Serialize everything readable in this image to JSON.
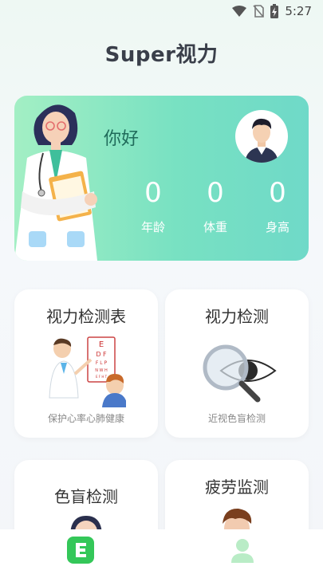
{
  "status_bar": {
    "time": "5:27",
    "icons": [
      "wifi-icon",
      "no-sim-icon",
      "battery-charging-icon"
    ]
  },
  "app": {
    "title": "Super视力"
  },
  "profile": {
    "greeting": "你好",
    "stats": [
      {
        "value": "0",
        "label": "年龄"
      },
      {
        "value": "0",
        "label": "体重"
      },
      {
        "value": "0",
        "label": "身高"
      }
    ]
  },
  "features": [
    {
      "title": "视力检测表",
      "subtitle": "保护心率心肺健康",
      "icon": "eye-chart-doctor-icon"
    },
    {
      "title": "视力检测",
      "subtitle": "近视色盲检测",
      "icon": "eye-magnifier-icon"
    },
    {
      "title": "色盲检测",
      "subtitle": "",
      "icon": "girl-avatar-icon"
    },
    {
      "title": "疲劳监测",
      "subtitle": "",
      "icon": "boy-avatar-icon"
    }
  ],
  "tab_bar": {
    "items": [
      {
        "icon": "home-e-icon",
        "active": true
      },
      {
        "icon": "profile-icon",
        "active": false
      }
    ]
  },
  "colors": {
    "accent": "#2ecc71",
    "card_gradient_start": "#a3efc4",
    "card_gradient_end": "#6fd9c8",
    "profile_inactive": "#b9ecc6"
  }
}
